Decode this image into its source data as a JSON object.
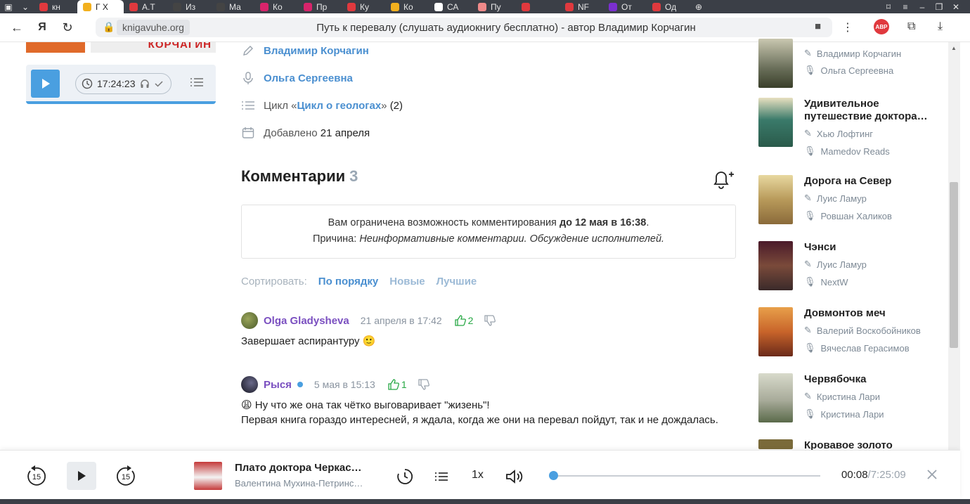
{
  "browser": {
    "tabs": [
      {
        "label": "кн",
        "color": "#e0393e"
      },
      {
        "label": "Г Х",
        "color": "#f2b01e"
      },
      {
        "label": "А.Т",
        "color": "#e0393e"
      },
      {
        "label": "Из",
        "color": "#444444"
      },
      {
        "label": "Ма",
        "color": "#444444"
      },
      {
        "label": "Ко",
        "color": "#d8246b"
      },
      {
        "label": "Пр",
        "color": "#d8246b"
      },
      {
        "label": "Ку",
        "color": "#e0393e"
      },
      {
        "label": "Ко",
        "color": "#f2b01e"
      },
      {
        "label": "СА",
        "color": "#ffffff"
      },
      {
        "label": "Пу",
        "color": "#f08a8a"
      },
      {
        "label": "",
        "color": "#e0393e"
      },
      {
        "label": "NF",
        "color": "#e0393e"
      },
      {
        "label": "От",
        "color": "#7b2fd0"
      },
      {
        "label": "Од",
        "color": "#e0393e"
      }
    ],
    "url_domain": "knigavuhe.org",
    "page_title": "Путь к перевалу (слушать аудиокнигу бесплатно) - автор Владимир Корчагин",
    "abp_label": "ABP"
  },
  "left": {
    "cover_text": "КОРЧАГИН",
    "duration": "17:24:23"
  },
  "book": {
    "author": "Владимир Корчагин",
    "reader": "Ольга Сергеевна",
    "cycle_prefix": "Цикл «",
    "cycle_name": "Цикл о геологах",
    "cycle_suffix": "»",
    "cycle_count": "(2)",
    "added_label": "Добавлено",
    "added_date": "21 апреля"
  },
  "comments": {
    "title": "Комментарии",
    "count": "3",
    "notice_line1_a": "Вам ограничена возможность комментирования ",
    "notice_line1_b": "до 12 мая в 16:38",
    "notice_line1_c": ".",
    "notice_line2_a": "Причина: ",
    "notice_line2_b": "Неинформативные комментарии. Обсуждение исполнителей.",
    "sort_label": "Сортировать:",
    "sort_options": [
      "По порядку",
      "Новые",
      "Лучшие"
    ],
    "items": [
      {
        "author": "Olga Gladysheva",
        "date": "21 апреля в 17:42",
        "likes": "2",
        "text": "Завершает аспирантуру 🙂",
        "avatar_color": "#6b7a3a",
        "online": false
      },
      {
        "author": "Рыся",
        "date": "5 мая в 15:13",
        "likes": "1",
        "text1": "😩 Ну что же она так чётко выговаривает \"жизень\"!",
        "text2": "Первая книга гораздо интересней, я ждала, когда же они на перевал пойдут, так и не дождалась.",
        "avatar_color": "#2a2a38",
        "online": true
      }
    ]
  },
  "sidebar": {
    "items": [
      {
        "title": "",
        "author": "Владимир Корчагин",
        "reader": "Ольга Сергеевна",
        "color": "#6a6f5a"
      },
      {
        "title": "Удивительное путешествие доктора…",
        "author": "Хью Лофтинг",
        "reader": "Mamedov Reads",
        "color": "#3a7a6a"
      },
      {
        "title": "Дорога на Север",
        "author": "Луис Ламур",
        "reader": "Ровшан Халиков",
        "color": "#b89a5a"
      },
      {
        "title": "Чэнси",
        "author": "Луис Ламур",
        "reader": "NextW",
        "color": "#5a2a3a"
      },
      {
        "title": "Довмонтов меч",
        "author": "Валерий Воскобойников",
        "reader": "Вячеслав Герасимов",
        "color": "#c8642a"
      },
      {
        "title": "Червябочка",
        "author": "Кристина Лари",
        "reader": "Кристина Лари",
        "color": "#a8ab9a"
      },
      {
        "title": "Кровавое золото",
        "author": "",
        "reader": "",
        "color": "#7a6a3a"
      }
    ]
  },
  "player": {
    "skip_back": "15",
    "skip_fwd": "15",
    "title": "Плато доктора Черкас…",
    "subtitle": "Валентина Мухина-Петринс…",
    "speed": "1x",
    "current": "00:08",
    "separator": "/",
    "total": "7:25:09",
    "progress": 0.0003
  }
}
